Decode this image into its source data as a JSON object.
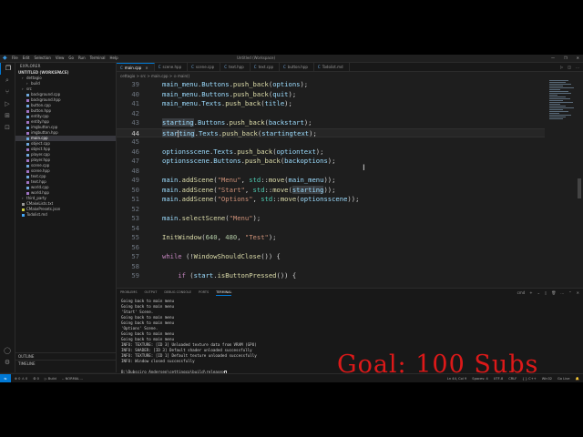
{
  "window": {
    "title": "Untitled (Workspace)",
    "menus": [
      "File",
      "Edit",
      "Selection",
      "View",
      "Go",
      "Run",
      "Terminal",
      "Help"
    ],
    "controls": [
      "—",
      "❐",
      "✕"
    ]
  },
  "activity_icons": [
    "files-icon",
    "search-icon",
    "source-control-icon",
    "run-debug-icon",
    "extensions-icon",
    "remote-icon"
  ],
  "activity_bottom_icons": [
    "account-icon",
    "settings-gear-icon"
  ],
  "sidebar": {
    "header": "EXPLORER",
    "workspace": "UNTITLED (WORKSPACE)",
    "items": [
      {
        "label": "dettagio",
        "depth": 1,
        "kind": "folder",
        "selected": false
      },
      {
        "label": "build",
        "depth": 2,
        "kind": "folder",
        "selected": false
      },
      {
        "label": "src",
        "depth": 1,
        "kind": "folder",
        "selected": false
      },
      {
        "label": "background.cpp",
        "depth": 2,
        "kind": "cpp",
        "selected": false
      },
      {
        "label": "background.hpp",
        "depth": 2,
        "kind": "hpp",
        "selected": false
      },
      {
        "label": "button.cpp",
        "depth": 2,
        "kind": "cpp",
        "selected": false
      },
      {
        "label": "button.hpp",
        "depth": 2,
        "kind": "hpp",
        "selected": false
      },
      {
        "label": "entity.cpp",
        "depth": 2,
        "kind": "cpp",
        "selected": false
      },
      {
        "label": "entity.hpp",
        "depth": 2,
        "kind": "hpp",
        "selected": false
      },
      {
        "label": "imgbutton.cpp",
        "depth": 2,
        "kind": "cpp",
        "selected": false
      },
      {
        "label": "imgbutton.hpp",
        "depth": 2,
        "kind": "hpp",
        "selected": false
      },
      {
        "label": "main.cpp",
        "depth": 2,
        "kind": "cpp",
        "selected": true
      },
      {
        "label": "object.cpp",
        "depth": 2,
        "kind": "cpp",
        "selected": false
      },
      {
        "label": "object.hpp",
        "depth": 2,
        "kind": "hpp",
        "selected": false
      },
      {
        "label": "player.cpp",
        "depth": 2,
        "kind": "cpp",
        "selected": false
      },
      {
        "label": "player.hpp",
        "depth": 2,
        "kind": "hpp",
        "selected": false
      },
      {
        "label": "scene.cpp",
        "depth": 2,
        "kind": "cpp",
        "selected": false
      },
      {
        "label": "scene.hpp",
        "depth": 2,
        "kind": "hpp",
        "selected": false
      },
      {
        "label": "text.cpp",
        "depth": 2,
        "kind": "cpp",
        "selected": false
      },
      {
        "label": "text.hpp",
        "depth": 2,
        "kind": "hpp",
        "selected": false
      },
      {
        "label": "world.cpp",
        "depth": 2,
        "kind": "cpp",
        "selected": false
      },
      {
        "label": "world.hpp",
        "depth": 2,
        "kind": "hpp",
        "selected": false
      },
      {
        "label": "third_party",
        "depth": 1,
        "kind": "folder",
        "selected": false
      },
      {
        "label": "CMakeLists.txt",
        "depth": 1,
        "kind": "txt",
        "selected": false
      },
      {
        "label": "CMakePresets.json",
        "depth": 1,
        "kind": "json",
        "selected": false
      },
      {
        "label": "Todolist.md",
        "depth": 1,
        "kind": "md",
        "selected": false
      }
    ],
    "outline": "OUTLINE",
    "timeline": "TIMELINE"
  },
  "colors": {
    "accent": "#0078d4",
    "cpp": "#6fa8dc",
    "hpp": "#a074c4",
    "folder": "#c09553",
    "txt": "#999999",
    "json": "#cbcb41",
    "md": "#42a5f5",
    "keyword": "#c586c0",
    "function": "#dcdcaa",
    "string": "#ce9178",
    "number": "#b5cea8",
    "type": "#4ec9b0",
    "variable": "#9cdcfe"
  },
  "tabs": [
    {
      "label": "main.cpp",
      "active": true
    },
    {
      "label": "scene.hpp",
      "active": false
    },
    {
      "label": "scene.cpp",
      "active": false
    },
    {
      "label": "text.hpp",
      "active": false
    },
    {
      "label": "text.cpp",
      "active": false
    },
    {
      "label": "button.hpp",
      "active": false
    },
    {
      "label": "Todolist.md",
      "active": false
    }
  ],
  "breadcrumb": "cettagio > src > main.cpp > ⊙ main()",
  "editor_lines": [
    {
      "n": "39",
      "tokens": [
        [
          "v",
          "main_menu"
        ],
        [
          "p",
          "."
        ],
        [
          "v",
          "Buttons"
        ],
        [
          "p",
          "."
        ],
        [
          "f",
          "push_back"
        ],
        [
          "p",
          "("
        ],
        [
          "v",
          "options"
        ],
        [
          "p",
          ");"
        ]
      ]
    },
    {
      "n": "40",
      "tokens": [
        [
          "v",
          "main_menu"
        ],
        [
          "p",
          "."
        ],
        [
          "v",
          "Buttons"
        ],
        [
          "p",
          "."
        ],
        [
          "f",
          "push_back"
        ],
        [
          "p",
          "("
        ],
        [
          "v",
          "quit"
        ],
        [
          "p",
          ");"
        ]
      ]
    },
    {
      "n": "41",
      "tokens": [
        [
          "v",
          "main_menu"
        ],
        [
          "p",
          "."
        ],
        [
          "v",
          "Texts"
        ],
        [
          "p",
          "."
        ],
        [
          "f",
          "push_back"
        ],
        [
          "p",
          "("
        ],
        [
          "v",
          "title"
        ],
        [
          "p",
          ");"
        ]
      ]
    },
    {
      "n": "42",
      "tokens": []
    },
    {
      "n": "43",
      "tokens": [
        [
          "vh",
          "starting"
        ],
        [
          "p",
          "."
        ],
        [
          "v",
          "Buttons"
        ],
        [
          "p",
          "."
        ],
        [
          "f",
          "push_back"
        ],
        [
          "p",
          "("
        ],
        [
          "v",
          "backstart"
        ],
        [
          "p",
          ");"
        ]
      ]
    },
    {
      "n": "44",
      "current": true,
      "tokens": [
        [
          "vh",
          "star"
        ],
        [
          "cur",
          ""
        ],
        [
          "vh",
          "ting"
        ],
        [
          "p",
          "."
        ],
        [
          "v",
          "Texts"
        ],
        [
          "p",
          "."
        ],
        [
          "f",
          "push_back"
        ],
        [
          "p",
          "("
        ],
        [
          "v",
          "startingtext"
        ],
        [
          "p",
          ");"
        ]
      ]
    },
    {
      "n": "45",
      "tokens": []
    },
    {
      "n": "46",
      "tokens": [
        [
          "v",
          "optionsscene"
        ],
        [
          "p",
          "."
        ],
        [
          "v",
          "Texts"
        ],
        [
          "p",
          "."
        ],
        [
          "f",
          "push_back"
        ],
        [
          "p",
          "("
        ],
        [
          "v",
          "optiontext"
        ],
        [
          "p",
          ");"
        ]
      ]
    },
    {
      "n": "47",
      "tokens": [
        [
          "v",
          "optionsscene"
        ],
        [
          "p",
          "."
        ],
        [
          "v",
          "Buttons"
        ],
        [
          "p",
          "."
        ],
        [
          "f",
          "push_back"
        ],
        [
          "p",
          "("
        ],
        [
          "v",
          "backoptions"
        ],
        [
          "p",
          ");"
        ]
      ]
    },
    {
      "n": "48",
      "tokens": []
    },
    {
      "n": "49",
      "tokens": [
        [
          "v",
          "main"
        ],
        [
          "p",
          "."
        ],
        [
          "f",
          "addScene"
        ],
        [
          "p",
          "("
        ],
        [
          "s",
          "\"Menu\""
        ],
        [
          "p",
          ", "
        ],
        [
          "t",
          "std"
        ],
        [
          "p",
          "::"
        ],
        [
          "f",
          "move"
        ],
        [
          "p",
          "("
        ],
        [
          "v",
          "main_menu"
        ],
        [
          "p",
          "));"
        ]
      ]
    },
    {
      "n": "50",
      "tokens": [
        [
          "v",
          "main"
        ],
        [
          "p",
          "."
        ],
        [
          "f",
          "addScene"
        ],
        [
          "p",
          "("
        ],
        [
          "s",
          "\"Start\""
        ],
        [
          "p",
          ", "
        ],
        [
          "t",
          "std"
        ],
        [
          "p",
          "::"
        ],
        [
          "f",
          "move"
        ],
        [
          "p",
          "("
        ],
        [
          "vh",
          "starting"
        ],
        [
          "p",
          "));"
        ]
      ]
    },
    {
      "n": "51",
      "tokens": [
        [
          "v",
          "main"
        ],
        [
          "p",
          "."
        ],
        [
          "f",
          "addScene"
        ],
        [
          "p",
          "("
        ],
        [
          "s",
          "\"Options\""
        ],
        [
          "p",
          ", "
        ],
        [
          "t",
          "std"
        ],
        [
          "p",
          "::"
        ],
        [
          "f",
          "move"
        ],
        [
          "p",
          "("
        ],
        [
          "v",
          "optionsscene"
        ],
        [
          "p",
          "));"
        ]
      ]
    },
    {
      "n": "52",
      "tokens": []
    },
    {
      "n": "53",
      "tokens": [
        [
          "v",
          "main"
        ],
        [
          "p",
          "."
        ],
        [
          "f",
          "selectScene"
        ],
        [
          "p",
          "("
        ],
        [
          "s",
          "\"Menu\""
        ],
        [
          "p",
          ");"
        ]
      ]
    },
    {
      "n": "54",
      "tokens": []
    },
    {
      "n": "55",
      "tokens": [
        [
          "f",
          "InitWindow"
        ],
        [
          "p",
          "("
        ],
        [
          "n",
          "640"
        ],
        [
          "p",
          ", "
        ],
        [
          "n",
          "480"
        ],
        [
          "p",
          ", "
        ],
        [
          "s",
          "\"Test\""
        ],
        [
          "p",
          ");"
        ]
      ]
    },
    {
      "n": "56",
      "tokens": []
    },
    {
      "n": "57",
      "tokens": [
        [
          "k",
          "while"
        ],
        [
          "p",
          " (!"
        ],
        [
          "f",
          "WindowShouldClose"
        ],
        [
          "p",
          "()) {"
        ]
      ]
    },
    {
      "n": "58",
      "tokens": []
    },
    {
      "n": "59",
      "tokens": [
        [
          "p",
          "    "
        ],
        [
          "k",
          "if"
        ],
        [
          "p",
          " ("
        ],
        [
          "v",
          "start"
        ],
        [
          "p",
          "."
        ],
        [
          "f",
          "isButtonPressed"
        ],
        [
          "p",
          "()) {"
        ]
      ]
    }
  ],
  "panel": {
    "tabs": [
      "PROBLEMS",
      "OUTPUT",
      "DEBUG CONSOLE",
      "PORTS",
      "TERMINAL"
    ],
    "active_tab": "TERMINAL",
    "actions": [
      "cmd",
      "+",
      "⌄",
      "▯",
      "🗑",
      "…",
      "⌃",
      "✕"
    ],
    "terminal_lines": [
      "Going back to main menu",
      "Going back to main menu",
      "'Start' Scene.",
      "Going back to main menu",
      "Going back to main menu",
      "'Options' Scene.",
      "Going back to main menu",
      "Going back to main menu",
      "INFO: TEXTURE: [ID 3] Unloaded texture data from VRAM (GPU)",
      "INFO: SHADER: [ID 3] Default shader unloaded successfully",
      "INFO: TEXTURE: [ID 1] Default texture unloaded successfully",
      "INFO: Window closed successfully"
    ],
    "prompt": "B:\\Dubsciro Andersen\\cettingcp\\build\\release>"
  },
  "status": {
    "left": [
      "⊗ 0  ⚠ 0",
      "⚙ 0",
      "▷ Build",
      "-- NORMAL --"
    ],
    "right": [
      "Ln 44, Col 9",
      "Spaces: 4",
      "UTF-8",
      "CRLF",
      "{ } C++",
      "Win32",
      "Go Live",
      "🔔"
    ]
  },
  "overlay": {
    "goal_text": "Goal: 100 Subs"
  }
}
